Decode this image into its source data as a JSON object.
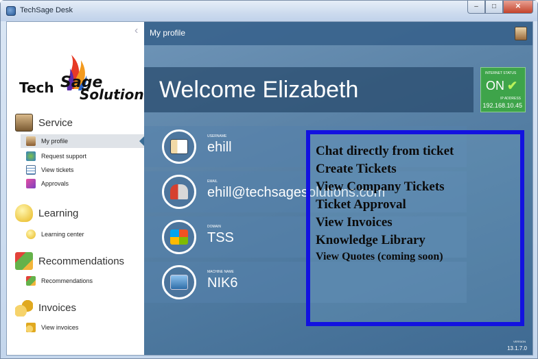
{
  "window": {
    "title": "TechSage Desk",
    "buttons": {
      "minimize": "–",
      "maximize": "□",
      "close": "✕"
    }
  },
  "sidebar": {
    "logo": {
      "part1": "Tech",
      "part2": "Sage",
      "part3": "Solutions"
    },
    "sections": [
      {
        "label": "Service",
        "icon": "service-icon",
        "items": [
          {
            "label": "My profile",
            "icon": "profile-icon",
            "active": true
          },
          {
            "label": "Request support",
            "icon": "request-support-icon"
          },
          {
            "label": "View tickets",
            "icon": "tickets-icon"
          },
          {
            "label": "Approvals",
            "icon": "approvals-icon"
          }
        ]
      },
      {
        "label": "Learning",
        "icon": "lightbulb-icon",
        "items": [
          {
            "label": "Learning center",
            "icon": "lightbulb-icon"
          }
        ]
      },
      {
        "label": "Recommendations",
        "icon": "recommendations-icon",
        "items": [
          {
            "label": "Recommendations",
            "icon": "recommendations-icon"
          }
        ]
      },
      {
        "label": "Invoices",
        "icon": "invoices-icon",
        "items": [
          {
            "label": "View invoices",
            "icon": "invoices-icon"
          }
        ]
      }
    ]
  },
  "main": {
    "page_title": "My profile",
    "welcome": "Welcome Elizabeth",
    "internet_status": {
      "label": "INTERNET STATUS",
      "value": "ON",
      "ip_label": "IP ADDRESS",
      "ip": "192.168.10.45"
    },
    "rows": [
      {
        "label": "USERNAME",
        "value": "ehill",
        "icon": "id-card-icon"
      },
      {
        "label": "EMAIL",
        "value": "ehill@techsagesolutions.com",
        "icon": "mailbox-icon"
      },
      {
        "label": "DOMAIN",
        "value": "TSS",
        "icon": "windows-logo-icon"
      },
      {
        "label": "MACHINE NAME",
        "value": "NIK6",
        "icon": "computer-icon"
      }
    ],
    "version_label": "VERSION",
    "version": "13.1.7.0"
  },
  "overlay": {
    "features": [
      "Chat directly from ticket",
      "Create Tickets",
      "View Company Tickets",
      "Ticket Approval",
      "View Invoices",
      "Knowledge Library",
      "View Quotes (coming soon)"
    ]
  },
  "colors": {
    "accent_blue": "#3f6a92",
    "status_green": "#3ea44a",
    "overlay_border": "#1212e0"
  }
}
